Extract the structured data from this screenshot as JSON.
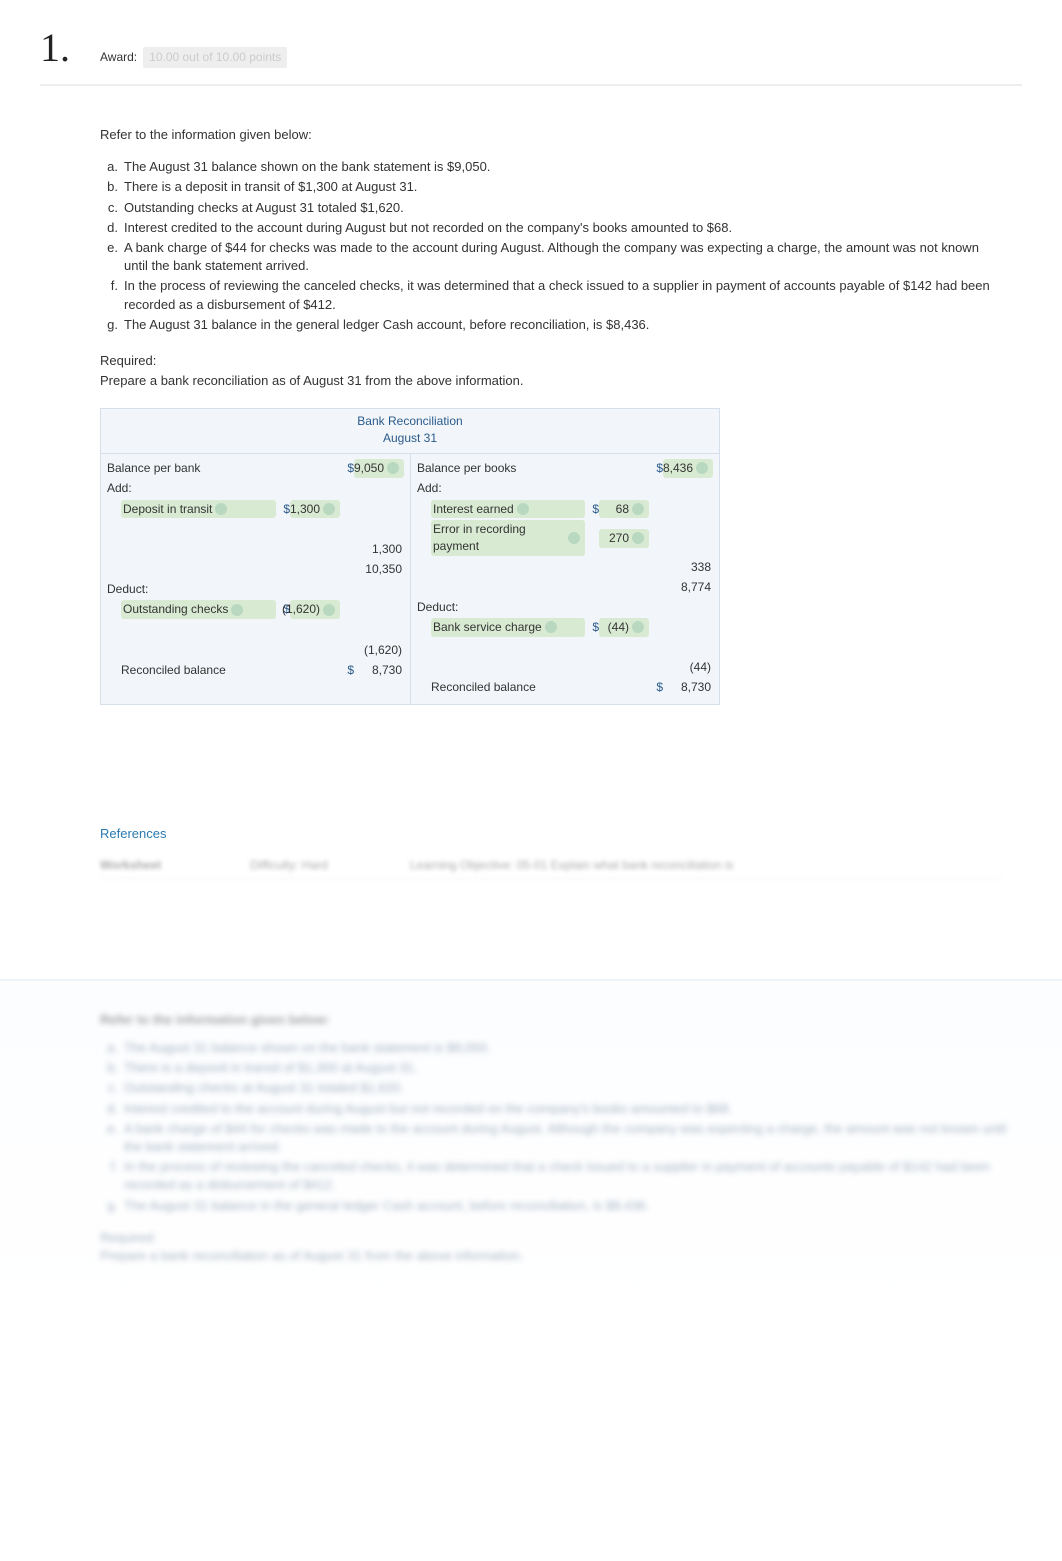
{
  "question_number": "1.",
  "award_label": "Award:",
  "award_value": "10.00 out of 10.00 points",
  "intro": "Refer to the information given below:",
  "items": [
    {
      "k": "a.",
      "t": "The August 31 balance shown on the bank statement is $9,050."
    },
    {
      "k": "b.",
      "t": "There is a deposit in transit of $1,300 at August 31."
    },
    {
      "k": "c.",
      "t": "Outstanding checks at August 31 totaled $1,620."
    },
    {
      "k": "d.",
      "t": "Interest credited to the account during August but not recorded on the company's books amounted to $68."
    },
    {
      "k": "e.",
      "t": "A bank charge of $44 for checks was made to the account during August. Although the company was expecting a charge, the amount was not known until the bank statement arrived."
    },
    {
      "k": "f.",
      "t": "In the process of reviewing the canceled checks, it was determined that a check issued to a supplier in payment of accounts payable of $142 had been recorded as a disbursement of $412."
    },
    {
      "k": "g.",
      "t": "The August 31 balance in the general ledger Cash account, before reconciliation, is $8,436."
    }
  ],
  "required_label": "Required:",
  "required_text": "Prepare a bank reconciliation as of August 31 from the above information.",
  "recon": {
    "title": "Bank Reconciliation",
    "date": "August 31",
    "bank": {
      "balance_label": "Balance per bank",
      "balance_sym": "$",
      "balance_amt": "9,050",
      "add_label": "Add:",
      "add_items": [
        {
          "label": "Deposit in transit",
          "sym": "$",
          "amt": "1,300"
        }
      ],
      "add_subtotal": "1,300",
      "running": "10,350",
      "deduct_label": "Deduct:",
      "deduct_items": [
        {
          "label": "Outstanding checks",
          "sym": "$",
          "amt": "(1,620)"
        }
      ],
      "deduct_subtotal": "(1,620)",
      "recon_label": "Reconciled balance",
      "recon_sym": "$",
      "recon_amt": "8,730"
    },
    "books": {
      "balance_label": "Balance per books",
      "balance_sym": "$",
      "balance_amt": "8,436",
      "add_label": "Add:",
      "add_items": [
        {
          "label": "Interest earned",
          "sym": "$",
          "amt": "68"
        },
        {
          "label": "Error in recording payment",
          "sym": "",
          "amt": "270"
        }
      ],
      "add_subtotal": "338",
      "running": "8,774",
      "deduct_label": "Deduct:",
      "deduct_items": [
        {
          "label": "Bank service charge",
          "sym": "$",
          "amt": "(44)"
        }
      ],
      "deduct_subtotal": "(44)",
      "recon_label": "Reconciled balance",
      "recon_sym": "$",
      "recon_amt": "8,730"
    }
  },
  "references": {
    "link": "References",
    "row": {
      "c1": "Worksheet",
      "c2": "Difficulty: Hard",
      "c3": "Learning Objective: 05-01 Explain what bank reconciliation is"
    }
  },
  "explain": {
    "heading": "Refer to the information given below:",
    "items": [
      {
        "k": "a.",
        "t": "The August 31 balance shown on the bank statement is $9,050."
      },
      {
        "k": "b.",
        "t": "There is a deposit in transit of $1,300 at August 31."
      },
      {
        "k": "c.",
        "t": "Outstanding checks at August 31 totaled $1,620."
      },
      {
        "k": "d.",
        "t": "Interest credited to the account during August but not recorded on the company's books amounted to $68."
      },
      {
        "k": "e.",
        "t": "A bank charge of $44 for checks was made to the account during August. Although the company was expecting a charge, the amount was not known until the bank statement arrived."
      },
      {
        "k": "f.",
        "t": "In the process of reviewing the canceled checks, it was determined that a check issued to a supplier in payment of accounts payable of $142 had been recorded as a disbursement of $412."
      },
      {
        "k": "g.",
        "t": "The August 31 balance in the general ledger Cash account, before reconciliation, is $8,436."
      }
    ],
    "req_label": "Required:",
    "req_text": "Prepare a bank reconciliation as of August 31 from the above information."
  }
}
